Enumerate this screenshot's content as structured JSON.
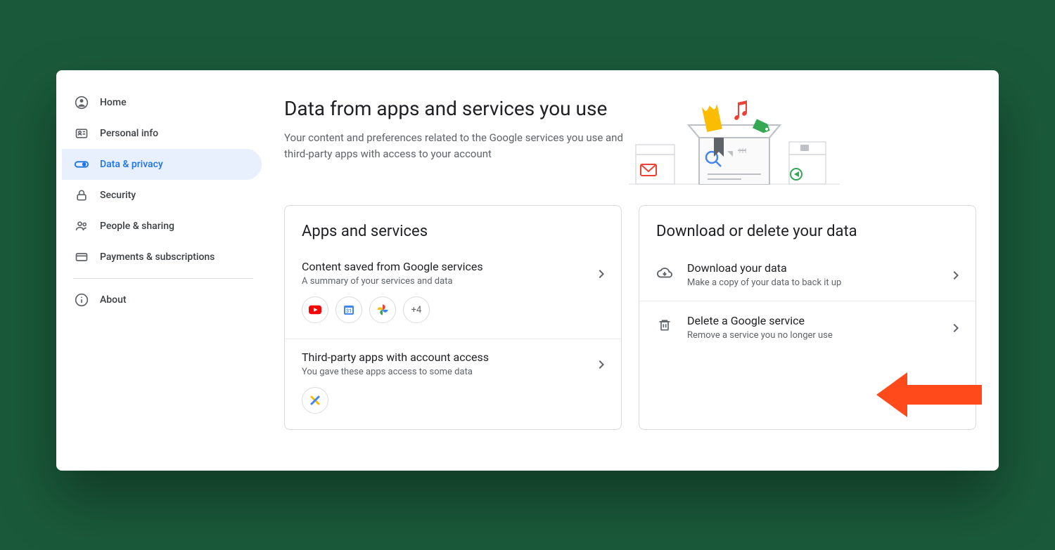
{
  "sidebar": {
    "items": [
      {
        "label": "Home",
        "icon": "person-circle-icon",
        "active": false
      },
      {
        "label": "Personal info",
        "icon": "id-card-icon",
        "active": false
      },
      {
        "label": "Data & privacy",
        "icon": "toggle-icon",
        "active": true
      },
      {
        "label": "Security",
        "icon": "lock-icon",
        "active": false
      },
      {
        "label": "People & sharing",
        "icon": "people-icon",
        "active": false
      },
      {
        "label": "Payments & subscriptions",
        "icon": "card-icon",
        "active": false
      }
    ],
    "about": {
      "label": "About",
      "icon": "info-icon"
    }
  },
  "header": {
    "title": "Data from apps and services you use",
    "subtitle": "Your content and preferences related to the Google services you use and third-party apps with access to your account"
  },
  "cards": {
    "apps": {
      "title": "Apps and services",
      "content_saved": {
        "title": "Content saved from Google services",
        "subtitle": "A summary of your services and data",
        "extra_chip": "+4"
      },
      "third_party": {
        "title": "Third-party apps with account access",
        "subtitle": "You gave these apps access to some data"
      }
    },
    "data": {
      "title": "Download or delete your data",
      "download": {
        "title": "Download your data",
        "subtitle": "Make a copy of your data to back it up"
      },
      "delete": {
        "title": "Delete a Google service",
        "subtitle": "Remove a service you no longer use"
      }
    }
  },
  "annotation": {
    "arrow_color": "#ff4a1c"
  }
}
